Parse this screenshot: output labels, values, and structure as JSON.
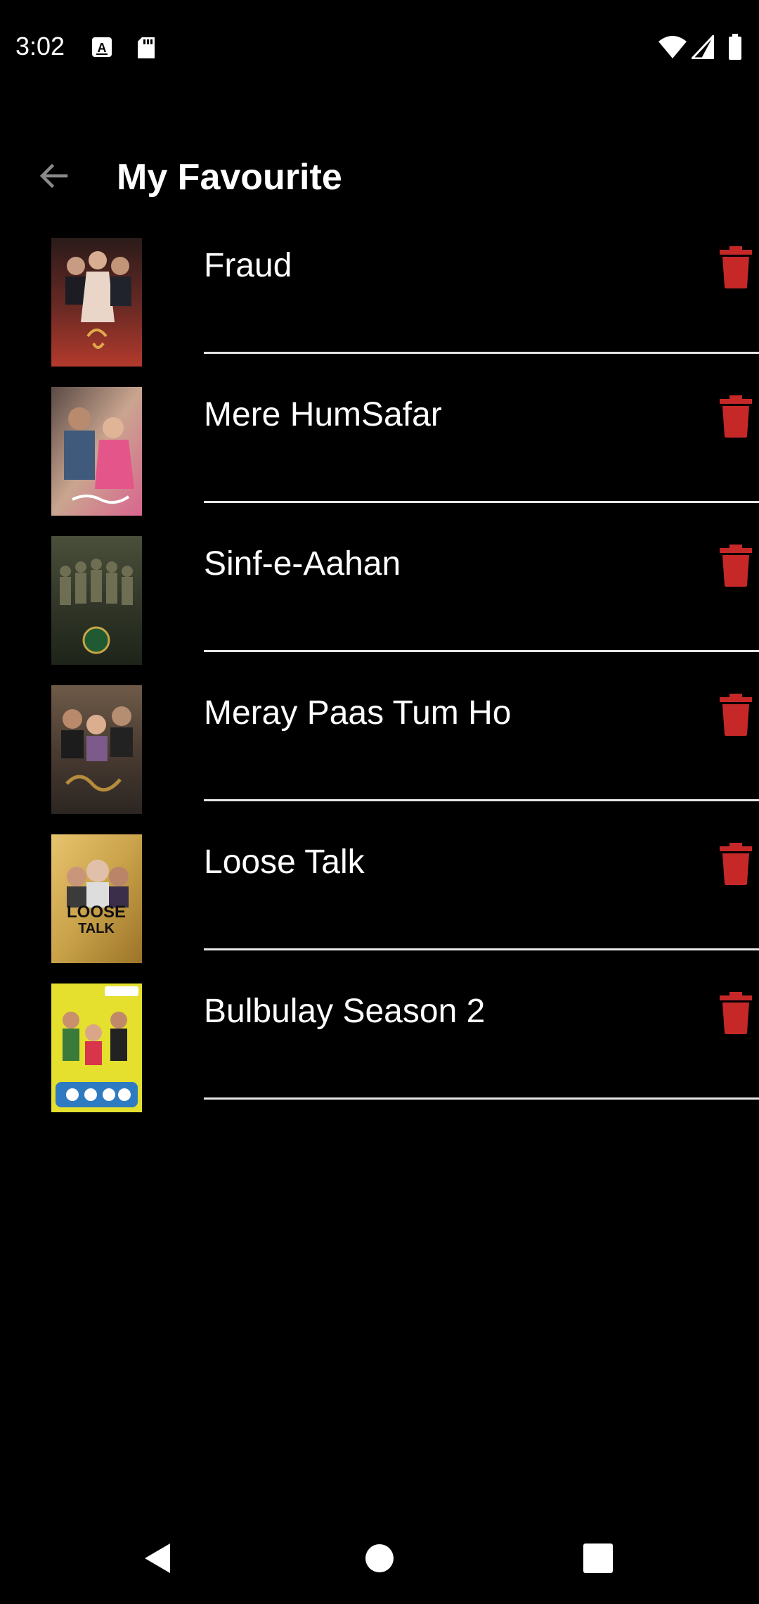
{
  "status_bar": {
    "time": "3:02",
    "icons": [
      "keyboard-a-icon",
      "sd-card-icon",
      "wifi-icon",
      "cell-signal-icon",
      "battery-icon"
    ]
  },
  "header": {
    "title": "My Favourite",
    "back_icon": "arrow-left-icon"
  },
  "favourites": [
    {
      "title": "Fraud",
      "poster_colors": [
        "#2a1b1a",
        "#6b2a24",
        "#b33a2c"
      ]
    },
    {
      "title": "Mere HumSafar",
      "poster_colors": [
        "#5a4a45",
        "#c9a58f",
        "#d9668f"
      ]
    },
    {
      "title": "Sinf-e-Aahan",
      "poster_colors": [
        "#2e3326",
        "#4a4f3a",
        "#1e2419"
      ]
    },
    {
      "title": "Meray Paas Tum Ho",
      "poster_colors": [
        "#2c2622",
        "#6e5a48",
        "#b58b3c"
      ]
    },
    {
      "title": "Loose Talk",
      "poster_colors": [
        "#c9a24a",
        "#e8c46e",
        "#9c7428"
      ]
    },
    {
      "title": "Bulbulay Season 2",
      "poster_colors": [
        "#e5df2e",
        "#2f7bc2",
        "#d9354a"
      ]
    }
  ],
  "delete_icon": "trash-icon",
  "colors": {
    "background": "#000000",
    "text": "#ffffff",
    "delete": "#c62828",
    "divider": "#e6e6e6",
    "back_arrow": "#8a8a8a"
  },
  "nav_bar": {
    "icons": [
      "back-triangle-icon",
      "home-circle-icon",
      "recents-square-icon"
    ]
  }
}
